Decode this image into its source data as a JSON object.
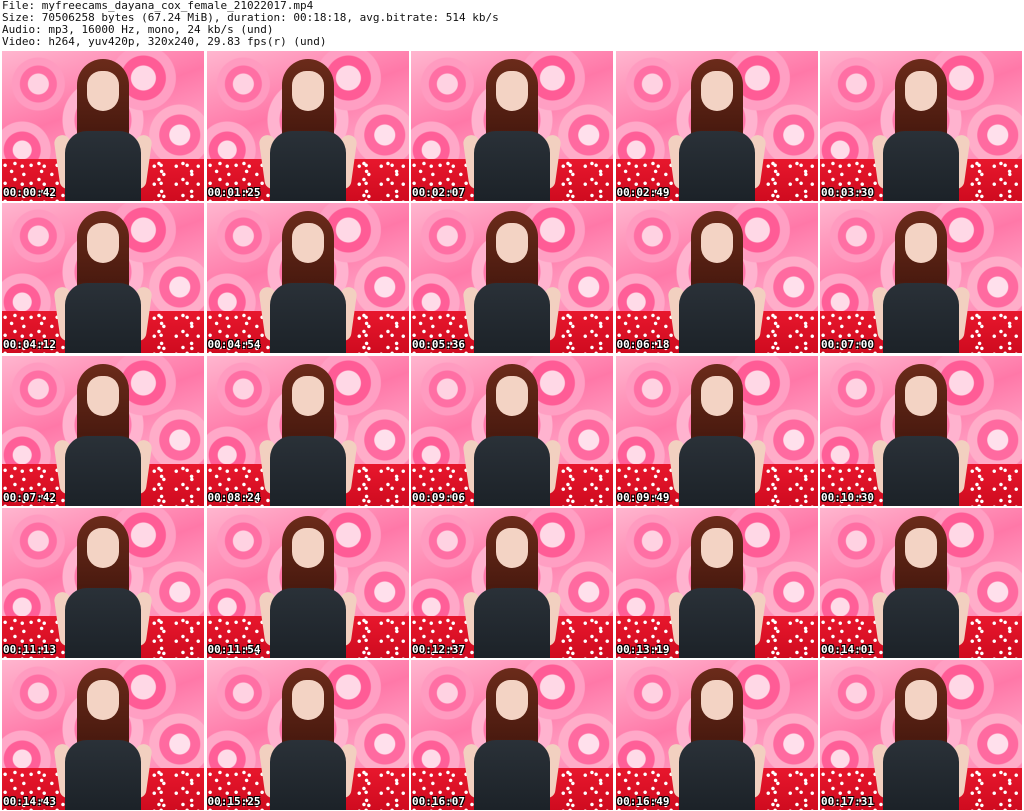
{
  "header": {
    "file_line": "File: myfreecams_dayana_cox_female_21022017.mp4",
    "size_line": "Size: 70506258 bytes (67.24 MiB), duration: 00:18:18, avg.bitrate: 514 kb/s",
    "audio_line": "Audio: mp3, 16000 Hz, mono, 24 kb/s (und)",
    "video_line": "Video: h264, yuv420p, 320x240, 29.83 fps(r) (und)"
  },
  "thumbnails": [
    {
      "timestamp": "00:00:42"
    },
    {
      "timestamp": "00:01:25"
    },
    {
      "timestamp": "00:02:07"
    },
    {
      "timestamp": "00:02:49"
    },
    {
      "timestamp": "00:03:30"
    },
    {
      "timestamp": "00:04:12"
    },
    {
      "timestamp": "00:04:54"
    },
    {
      "timestamp": "00:05:36"
    },
    {
      "timestamp": "00:06:18"
    },
    {
      "timestamp": "00:07:00"
    },
    {
      "timestamp": "00:07:42"
    },
    {
      "timestamp": "00:08:24"
    },
    {
      "timestamp": "00:09:06"
    },
    {
      "timestamp": "00:09:49"
    },
    {
      "timestamp": "00:10:30"
    },
    {
      "timestamp": "00:11:13"
    },
    {
      "timestamp": "00:11:54"
    },
    {
      "timestamp": "00:12:37"
    },
    {
      "timestamp": "00:13:19"
    },
    {
      "timestamp": "00:14:01"
    },
    {
      "timestamp": "00:14:43"
    },
    {
      "timestamp": "00:15:25"
    },
    {
      "timestamp": "00:16:07"
    },
    {
      "timestamp": "00:16:49"
    },
    {
      "timestamp": "00:17:31"
    }
  ]
}
